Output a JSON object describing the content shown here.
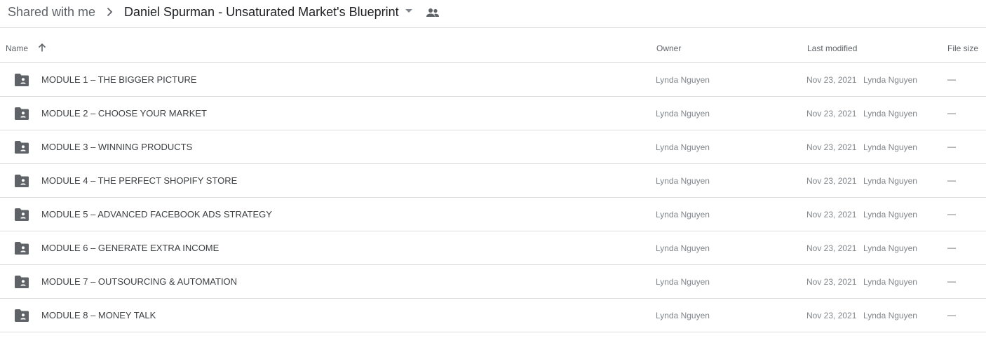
{
  "breadcrumb": {
    "root": "Shared with me",
    "current": "Daniel Spurman - Unsaturated Market's Blueprint"
  },
  "icons": {
    "separator": "chevron-right-icon",
    "dropdown": "arrow-drop-down-icon",
    "shared": "people-icon",
    "sort": "arrow-upward-icon",
    "folder": "shared-folder-icon"
  },
  "columns": {
    "name": "Name",
    "owner": "Owner",
    "last_modified": "Last modified",
    "file_size": "File size"
  },
  "colors": {
    "icon_gray": "#5f6368",
    "divider": "#dadce0",
    "text_primary": "#3c4043",
    "text_secondary": "#80868b"
  },
  "rows": [
    {
      "name": "MODULE 1 – THE BIGGER PICTURE",
      "owner": "Lynda Nguyen",
      "date": "Nov 23, 2021",
      "modified_by": "Lynda Nguyen",
      "size": "—"
    },
    {
      "name": "MODULE 2 – CHOOSE YOUR MARKET",
      "owner": "Lynda Nguyen",
      "date": "Nov 23, 2021",
      "modified_by": "Lynda Nguyen",
      "size": "—"
    },
    {
      "name": "MODULE 3 – WINNING PRODUCTS",
      "owner": "Lynda Nguyen",
      "date": "Nov 23, 2021",
      "modified_by": "Lynda Nguyen",
      "size": "—"
    },
    {
      "name": "MODULE 4 – THE PERFECT SHOPIFY STORE",
      "owner": "Lynda Nguyen",
      "date": "Nov 23, 2021",
      "modified_by": "Lynda Nguyen",
      "size": "—"
    },
    {
      "name": "MODULE 5 – ADVANCED FACEBOOK ADS STRATEGY",
      "owner": "Lynda Nguyen",
      "date": "Nov 23, 2021",
      "modified_by": "Lynda Nguyen",
      "size": "—"
    },
    {
      "name": "MODULE 6 – GENERATE EXTRA INCOME",
      "owner": "Lynda Nguyen",
      "date": "Nov 23, 2021",
      "modified_by": "Lynda Nguyen",
      "size": "—"
    },
    {
      "name": "MODULE 7 – OUTSOURCING & AUTOMATION",
      "owner": "Lynda Nguyen",
      "date": "Nov 23, 2021",
      "modified_by": "Lynda Nguyen",
      "size": "—"
    },
    {
      "name": "MODULE 8 – MONEY TALK",
      "owner": "Lynda Nguyen",
      "date": "Nov 23, 2021",
      "modified_by": "Lynda Nguyen",
      "size": "—"
    }
  ]
}
